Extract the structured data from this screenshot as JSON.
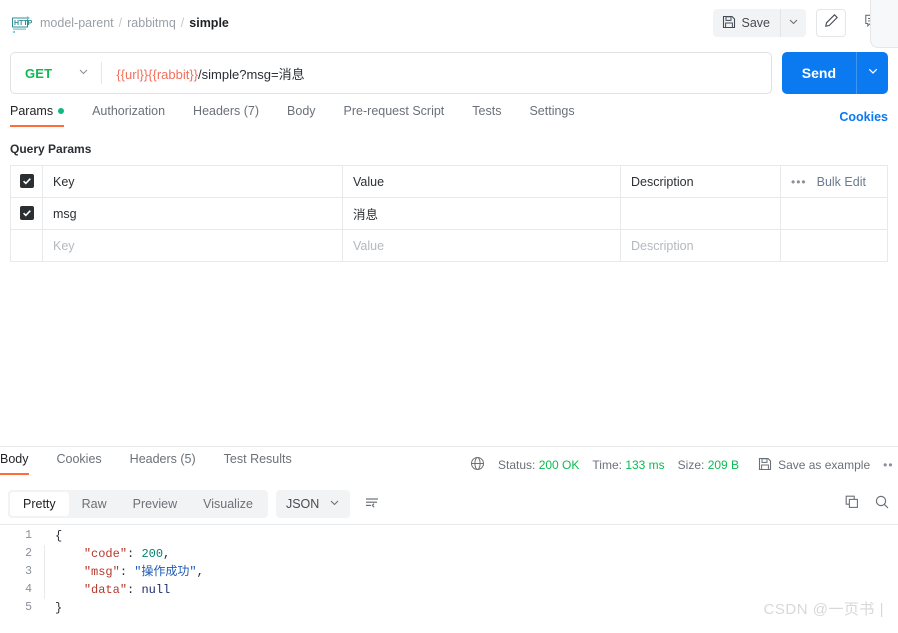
{
  "header": {
    "icon": "http-protocol-icon",
    "breadcrumb": [
      {
        "label": "model-parent",
        "active": false
      },
      {
        "label": "rabbitmq",
        "active": false
      },
      {
        "label": "simple",
        "active": true
      }
    ],
    "separator": "/",
    "save_label": "Save",
    "save_icon": "floppy-disk-icon",
    "save_caret_icon": "chevron-down-icon",
    "edit_icon": "pencil-icon",
    "comment_icon": "comment-icon"
  },
  "request": {
    "method": "GET",
    "method_caret_icon": "chevron-down-icon",
    "url_variables": "{{url}}{{rabbit}}",
    "url_path": "/simple?msg=消息",
    "send_label": "Send",
    "send_caret_icon": "chevron-down-icon",
    "accent_blue": "#0b79f0",
    "method_green": "#0cbb52",
    "variable_red": "#f2705d"
  },
  "request_tabs": [
    {
      "label": "Params",
      "active": true,
      "dot": true
    },
    {
      "label": "Authorization",
      "active": false,
      "dot": false
    },
    {
      "label": "Headers (7)",
      "active": false,
      "dot": false
    },
    {
      "label": "Body",
      "active": false,
      "dot": false
    },
    {
      "label": "Pre-request Script",
      "active": false,
      "dot": false
    },
    {
      "label": "Tests",
      "active": false,
      "dot": false
    },
    {
      "label": "Settings",
      "active": false,
      "dot": false
    }
  ],
  "cookies_link": "Cookies",
  "query_params": {
    "title": "Query Params",
    "columns": {
      "key": "Key",
      "value": "Value",
      "description": "Description"
    },
    "bulk_edit_label": "Bulk Edit",
    "bulk_edit_icon": "ellipsis-icon",
    "rows": [
      {
        "checked": true,
        "key": "msg",
        "value": "消息",
        "description": "",
        "placeholder": false
      }
    ],
    "placeholder_row": {
      "key": "Key",
      "value": "Value",
      "description": "Description"
    }
  },
  "response": {
    "tabs": [
      {
        "label": "Body",
        "active": true
      },
      {
        "label": "Cookies",
        "active": false
      },
      {
        "label": "Headers (5)",
        "active": false
      },
      {
        "label": "Test Results",
        "active": false
      }
    ],
    "globe_icon": "globe-icon",
    "status_label": "Status:",
    "status_value": "200 OK",
    "time_label": "Time:",
    "time_value": "133 ms",
    "size_label": "Size:",
    "size_value": "209 B",
    "save_example_label": "Save as example",
    "save_example_icon": "floppy-disk-icon",
    "more_icon": "ellipsis-icon",
    "status_green": "#0cbb52",
    "view_modes": [
      {
        "label": "Pretty",
        "selected": true
      },
      {
        "label": "Raw",
        "selected": false
      },
      {
        "label": "Preview",
        "selected": false
      },
      {
        "label": "Visualize",
        "selected": false
      }
    ],
    "format": "JSON",
    "format_caret_icon": "chevron-down-icon",
    "wrap_icon": "word-wrap-icon",
    "copy_icon": "copy-icon",
    "search_icon": "search-icon",
    "body_lines": [
      {
        "no": "1",
        "indent": 0
      },
      {
        "no": "2",
        "indent": 1
      },
      {
        "no": "3",
        "indent": 1
      },
      {
        "no": "4",
        "indent": 1
      },
      {
        "no": "5",
        "indent": 0
      }
    ],
    "body_tokens": {
      "open_brace": "{",
      "close_brace": "}",
      "code_key": "\"code\"",
      "code_value": "200",
      "msg_key": "\"msg\"",
      "msg_value": "\"操作成功\"",
      "data_key": "\"data\"",
      "data_value": "null",
      "colon": ": ",
      "comma": ","
    }
  },
  "watermark": "CSDN @一页书 |"
}
